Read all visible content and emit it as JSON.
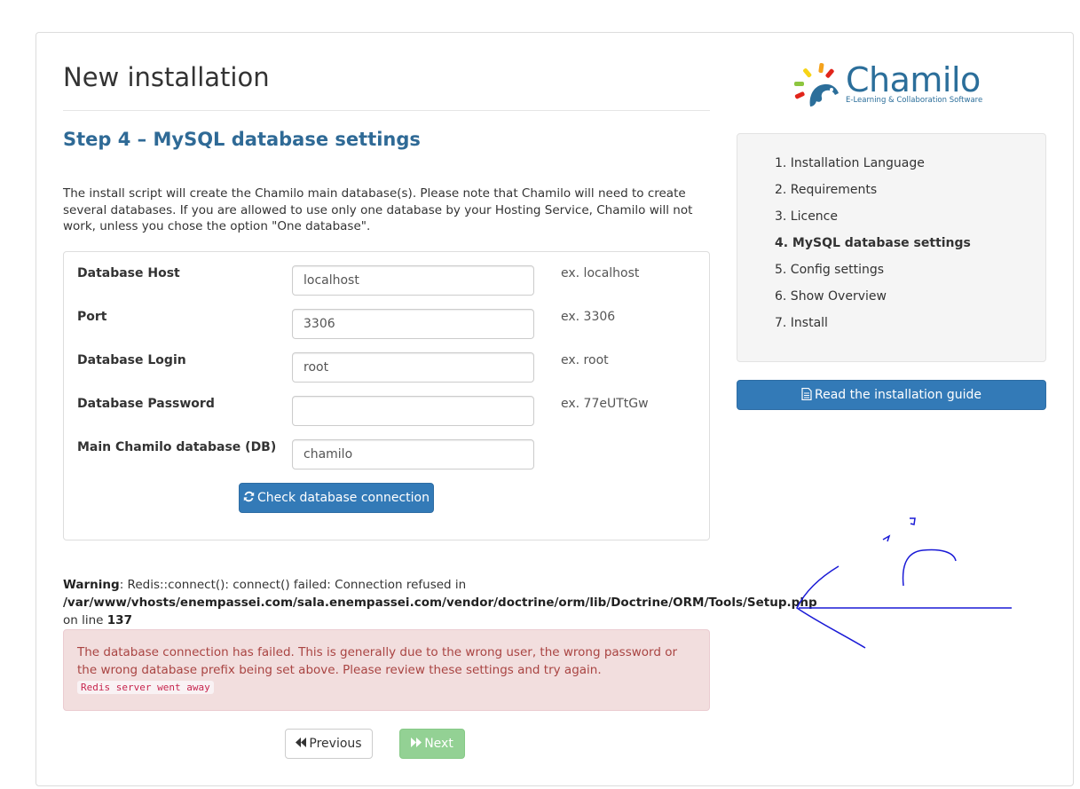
{
  "page": {
    "title": "New installation",
    "step_title": "Step 4 – MySQL database settings",
    "intro": "The install script will create the Chamilo main database(s). Please note that Chamilo will need to create several databases. If you are allowed to use only one database by your Hosting Service, Chamilo will not work, unless you chose the option \"One database\"."
  },
  "form": {
    "fields": [
      {
        "label": "Database Host",
        "value": "localhost",
        "example": "ex. localhost"
      },
      {
        "label": "Port",
        "value": "3306",
        "example": "ex. 3306"
      },
      {
        "label": "Database Login",
        "value": "root",
        "example": "ex. root"
      },
      {
        "label": "Database Password",
        "value": "",
        "example": "ex. 77eUTtGw"
      },
      {
        "label": "Main Chamilo database (DB)",
        "value": "chamilo",
        "example": ""
      }
    ],
    "check_button": "Check database connection"
  },
  "warning": {
    "label": "Warning",
    "message": ": Redis::connect(): connect() failed: Connection refused in",
    "path": "/var/www/vhosts/enempassei.com/sala.enempassei.com/vendor/doctrine/orm/lib/Doctrine/ORM/Tools/Setup.php",
    "line_prefix": "on line",
    "line_number": "137"
  },
  "error": {
    "message": "The database connection has failed. This is generally due to the wrong user, the wrong password or the wrong database prefix being set above. Please review these settings and try again.",
    "code": "Redis server went away"
  },
  "nav": {
    "previous": "Previous",
    "next": "Next"
  },
  "sidebar": {
    "logo_text": "Chamilo",
    "logo_tagline": "E-Learning & Collaboration Software",
    "steps": [
      {
        "label": "1. Installation Language",
        "active": false
      },
      {
        "label": "2. Requirements",
        "active": false
      },
      {
        "label": "3. Licence",
        "active": false
      },
      {
        "label": "4. MySQL database settings",
        "active": true
      },
      {
        "label": "5. Config settings",
        "active": false
      },
      {
        "label": "6. Show Overview",
        "active": false
      },
      {
        "label": "7. Install",
        "active": false
      }
    ],
    "guide_button": "Read the installation guide"
  },
  "icons": {
    "check_button": "refresh-icon",
    "guide_button": "file-text-icon",
    "previous": "backward-icon",
    "next": "forward-icon",
    "logo": "chamilo-chameleon-logo-icon"
  },
  "colors": {
    "primary": "#337ab7",
    "heading": "#2f6a96",
    "success_disabled": "#93d194",
    "error_text": "#a94442",
    "error_bg": "#f2dede",
    "annotation": "#1a1ad6"
  }
}
